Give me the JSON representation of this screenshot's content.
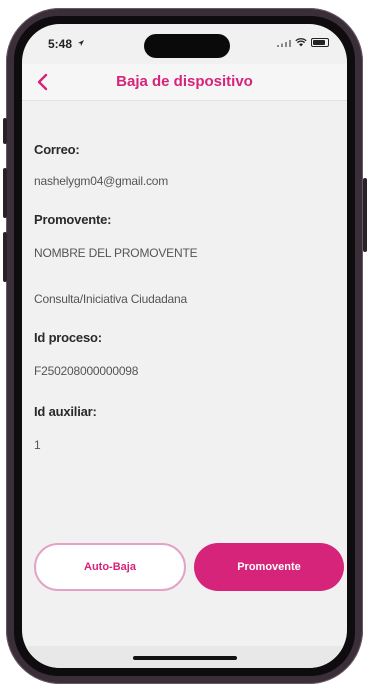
{
  "status_bar": {
    "time": "5:48",
    "icons": [
      "location-arrow-icon",
      "signal-icon",
      "wifi-icon",
      "battery-icon"
    ]
  },
  "nav": {
    "title": "Baja de dispositivo",
    "back_icon": "chevron-left-icon"
  },
  "details": {
    "correo_label": "Correo:",
    "correo_value": "nashelygm04@gmail.com",
    "promovente_label": "Promovente:",
    "promovente_value": "NOMBRE DEL PROMOVENTE",
    "tipo_value": "Consulta/Iniciativa Ciudadana",
    "id_proceso_label": "Id proceso:",
    "id_proceso_value": "F250208000000098",
    "id_auxiliar_label": "Id auxiliar:",
    "id_auxiliar_value": "1"
  },
  "actions": {
    "auto_baja_label": "Auto-Baja",
    "promovente_label": "Promovente"
  },
  "colors": {
    "accent": "#d6247a",
    "accent_border": "#e3a3c6",
    "background": "#f2f1f1"
  }
}
